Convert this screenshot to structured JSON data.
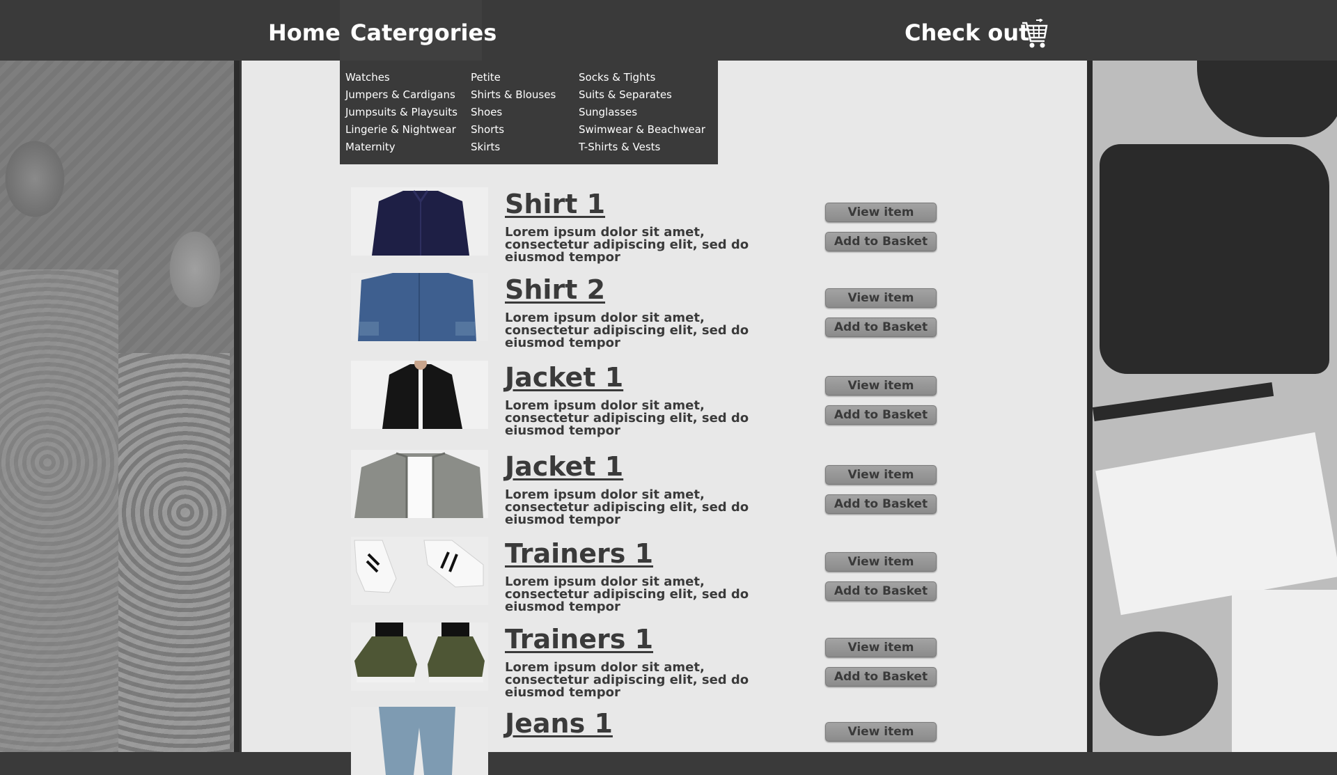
{
  "nav": {
    "home": "Home",
    "categories": "Catergories",
    "checkout": "Check out",
    "cart_icon": "shopping-cart-icon"
  },
  "categories_menu": {
    "col1": [
      "Watches",
      "Jumpers & Cardigans",
      "Jumpsuits & Playsuits",
      "Lingerie & Nightwear",
      "Maternity"
    ],
    "col2": [
      "Petite",
      "Shirts & Blouses",
      "Shoes",
      "Shorts",
      "Skirts"
    ],
    "col3": [
      "Socks & Tights",
      "Suits & Separates",
      "Sunglasses",
      "Swimwear & Beachwear",
      "T-Shirts & Vests"
    ]
  },
  "products": [
    {
      "title": "Shirt 1",
      "desc": "Lorem ipsum dolor sit amet, consectetur adipiscing elit, sed do eiusmod tempor",
      "view": "View item",
      "add": "Add to Basket",
      "image": "navy-shirt"
    },
    {
      "title": "Shirt 2",
      "desc": "Lorem ipsum dolor sit amet, consectetur adipiscing elit, sed do eiusmod tempor",
      "view": "View item",
      "add": "Add to Basket",
      "image": "denim-shirt"
    },
    {
      "title": "Jacket 1",
      "desc": "Lorem ipsum dolor sit amet, consectetur adipiscing elit, sed do eiusmod tempor",
      "view": "View item",
      "add": "Add to Basket",
      "image": "black-jacket"
    },
    {
      "title": "Jacket 1",
      "desc": "Lorem ipsum dolor sit amet, consectetur adipiscing elit, sed do eiusmod tempor",
      "view": "View item",
      "add": "Add to Basket",
      "image": "grey-bomber-jacket"
    },
    {
      "title": "Trainers 1",
      "desc": "Lorem ipsum dolor sit amet, consectetur adipiscing elit, sed do eiusmod tempor",
      "view": "View item",
      "add": "Add to Basket",
      "image": "white-trainers"
    },
    {
      "title": "Trainers 1",
      "desc": "Lorem ipsum dolor sit amet, consectetur adipiscing elit, sed do eiusmod tempor",
      "view": "View item",
      "add": "Add to Basket",
      "image": "olive-trainers"
    },
    {
      "title": "Jeans 1",
      "desc": "",
      "view": "View item",
      "add": "",
      "image": "light-jeans"
    }
  ],
  "colors": {
    "bar": "#3a3a3a",
    "panel": "#e8e8e8",
    "text": "#3a3a3a",
    "button": "#9b9b9b"
  }
}
